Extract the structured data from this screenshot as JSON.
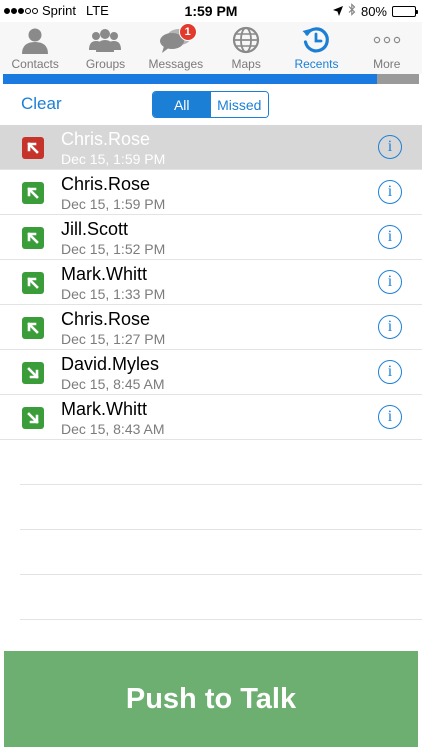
{
  "status_bar": {
    "carrier": "Sprint",
    "network": "LTE",
    "time": "1:59 PM",
    "battery": "80%",
    "signal_dots_on": 3,
    "signal_dots_total": 5
  },
  "tabs": [
    {
      "label": "Contacts",
      "icon": "contacts-icon",
      "active": false
    },
    {
      "label": "Groups",
      "icon": "groups-icon",
      "active": false
    },
    {
      "label": "Messages",
      "icon": "messages-icon",
      "active": false,
      "badge": "1"
    },
    {
      "label": "Maps",
      "icon": "globe-icon",
      "active": false
    },
    {
      "label": "Recents",
      "icon": "recents-icon",
      "active": true
    },
    {
      "label": "More",
      "icon": "more-icon",
      "active": false
    }
  ],
  "progress": {
    "value": 0.9
  },
  "controls": {
    "clear_label": "Clear",
    "segments": [
      {
        "label": "All",
        "selected": true
      },
      {
        "label": "Missed",
        "selected": false
      }
    ]
  },
  "recents": [
    {
      "name": "Chris.Rose",
      "time": "Dec 15, 1:59 PM",
      "type": "missed",
      "selected": true
    },
    {
      "name": "Chris.Rose",
      "time": "Dec 15, 1:59 PM",
      "type": "outgoing",
      "selected": false
    },
    {
      "name": "Jill.Scott",
      "time": "Dec 15, 1:52 PM",
      "type": "outgoing",
      "selected": false
    },
    {
      "name": "Mark.Whitt",
      "time": "Dec 15, 1:33 PM",
      "type": "outgoing",
      "selected": false
    },
    {
      "name": "Chris.Rose",
      "time": "Dec 15, 1:27 PM",
      "type": "outgoing",
      "selected": false
    },
    {
      "name": "David.Myles",
      "time": "Dec 15, 8:45 AM",
      "type": "incoming",
      "selected": false
    },
    {
      "name": "Mark.Whitt",
      "time": "Dec 15, 8:43 AM",
      "type": "incoming",
      "selected": false
    }
  ],
  "push_to_talk": {
    "label": "Push to Talk"
  },
  "colors": {
    "accent": "#1c7fd6",
    "ptt_green": "#6caf70",
    "call_green": "#3a9d3a",
    "call_red": "#c6332a",
    "badge_red": "#e23b2e"
  }
}
